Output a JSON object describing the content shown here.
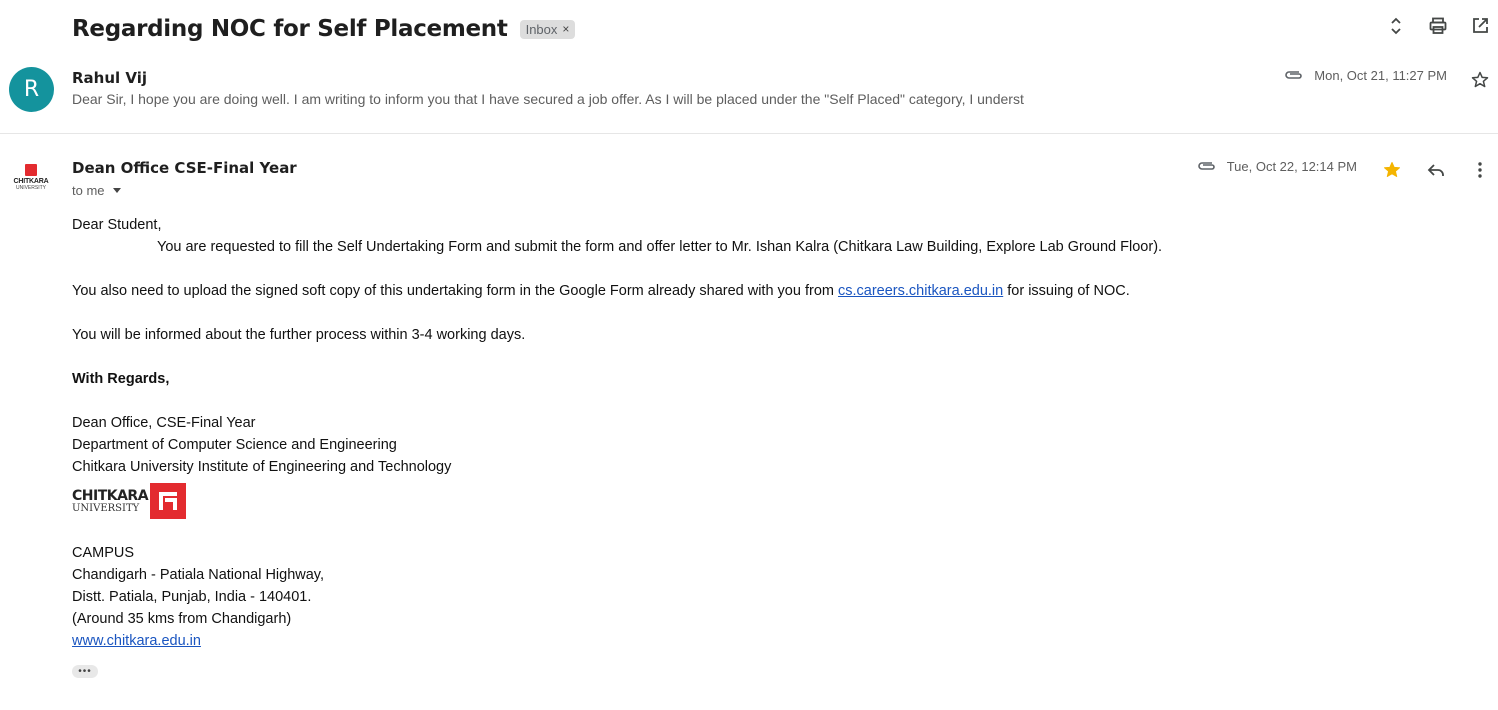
{
  "thread": {
    "subject": "Regarding NOC for Self Placement",
    "label": "Inbox",
    "label_remove": "×"
  },
  "toolbar_icons": [
    "expand-collapse-icon",
    "print-icon",
    "open-new-window-icon"
  ],
  "message1": {
    "avatar_initial": "R",
    "avatar_color": "#14939d",
    "sender": "Rahul Vij",
    "snippet": "Dear Sir, I hope you are doing well. I am writing to inform you that I have secured a job offer. As I will be placed under the \"Self Placed\" category, I underst",
    "date": "Mon, Oct 21, 11:27 PM",
    "has_attachment": true,
    "starred": false
  },
  "message2": {
    "sender": "Dean Office CSE-Final Year",
    "to": "to me",
    "date": "Tue, Oct 22, 12:14 PM",
    "has_attachment": true,
    "starred": true,
    "star_color": "#f4b400",
    "avatar_logo_text": "CHITKARA",
    "avatar_logo_sub": "UNIVERSITY",
    "body": {
      "greeting": "Dear Student,",
      "para1": "You are requested to fill the Self Undertaking Form and submit the form and offer letter to Mr. Ishan Kalra (Chitkara Law Building, Explore Lab Ground Floor).",
      "para2_before": "You also need to upload the signed soft copy of this undertaking form in the Google Form already shared with you from ",
      "para2_link": "cs.careers.chitkara.edu.in",
      "para2_after": " for issuing of NOC.",
      "para3": "You will be informed about the further process within 3-4 working days.",
      "regards": "With Regards,",
      "sig_line1": "Dean Office, CSE-Final Year",
      "sig_line2": "Department of Computer Science and Engineering",
      "sig_line3": "Chitkara University Institute of Engineering and Technology",
      "logo_word": "CHITKARA",
      "logo_sub": "UNIVERSITY",
      "campus": "CAMPUS",
      "addr1": "Chandigarh - Patiala National Highway,",
      "addr2": "Distt. Patiala, Punjab, India - 140401.",
      "addr3": "(Around 35 kms from Chandigarh)",
      "website": "www.chitkara.edu.in",
      "more": "•••"
    }
  }
}
